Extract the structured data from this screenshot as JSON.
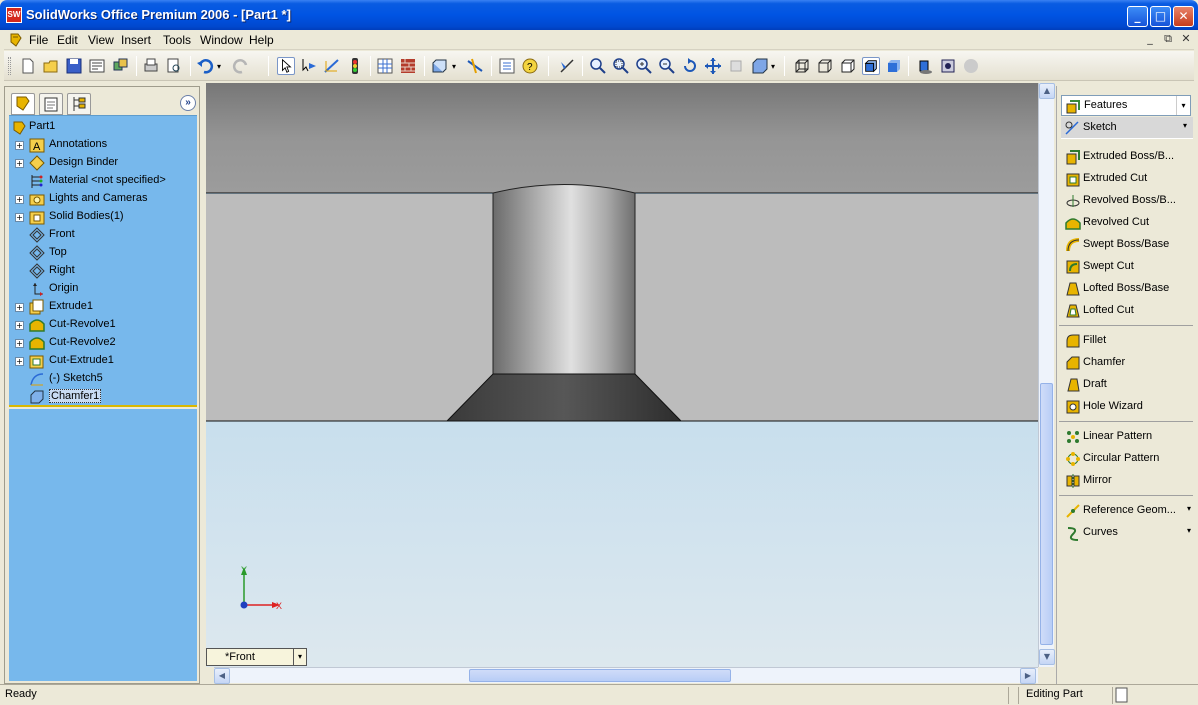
{
  "window": {
    "app_icon": "SW",
    "title": "SolidWorks Office Premium 2006 - [Part1 *]",
    "minimize": "_",
    "maximize": "□",
    "close": "✕"
  },
  "menu": {
    "items": [
      "File",
      "Edit",
      "View",
      "Insert",
      "Tools",
      "Window",
      "Help"
    ],
    "mdi": [
      "_",
      "⧉",
      "✕"
    ]
  },
  "feature_manager": {
    "collapse": "»",
    "tree": [
      {
        "label": "Part1",
        "icon": "part-icon",
        "expandable": false,
        "root": true
      },
      {
        "label": "Annotations",
        "icon": "annotations-icon",
        "expandable": true
      },
      {
        "label": "Design Binder",
        "icon": "design-binder-icon",
        "expandable": true
      },
      {
        "label": "Material <not specified>",
        "icon": "material-icon",
        "expandable": false
      },
      {
        "label": "Lights and Cameras",
        "icon": "lights-cameras-icon",
        "expandable": true
      },
      {
        "label": "Solid Bodies(1)",
        "icon": "solid-bodies-icon",
        "expandable": true
      },
      {
        "label": "Front",
        "icon": "plane-icon",
        "expandable": false
      },
      {
        "label": "Top",
        "icon": "plane-icon",
        "expandable": false
      },
      {
        "label": "Right",
        "icon": "plane-icon",
        "expandable": false
      },
      {
        "label": "Origin",
        "icon": "origin-icon",
        "expandable": false
      },
      {
        "label": "Extrude1",
        "icon": "extrude-icon",
        "expandable": true
      },
      {
        "label": "Cut-Revolve1",
        "icon": "cut-revolve-icon",
        "expandable": true
      },
      {
        "label": "Cut-Revolve2",
        "icon": "cut-revolve-icon",
        "expandable": true
      },
      {
        "label": "Cut-Extrude1",
        "icon": "cut-extrude-icon",
        "expandable": true
      },
      {
        "label": "(-) Sketch5",
        "icon": "sketch-icon",
        "expandable": false
      },
      {
        "label": "Chamfer1",
        "icon": "chamfer-icon",
        "expandable": false,
        "selected": true
      }
    ]
  },
  "viewport": {
    "view_name": "*Front",
    "triad_y": "Y",
    "triad_x": "X"
  },
  "command_manager": {
    "features_dropdown": "Features",
    "sketch_dropdown": "Sketch",
    "groups": [
      [
        "Extruded Boss/B...",
        "Extruded Cut",
        "Revolved Boss/B...",
        "Revolved Cut",
        "Swept Boss/Base",
        "Swept Cut",
        "Lofted Boss/Base",
        "Lofted Cut"
      ],
      [
        "Fillet",
        "Chamfer",
        "Draft",
        "Hole Wizard"
      ],
      [
        "Linear Pattern",
        "Circular Pattern",
        "Mirror"
      ],
      [
        "Reference Geom...",
        "Curves"
      ]
    ]
  },
  "status": {
    "left": "Ready",
    "mode": "Editing Part"
  },
  "colors": {
    "title_blue": "#0054e3",
    "tree_bg": "#77b8ec",
    "viewport_top": "#a8d0ec"
  }
}
